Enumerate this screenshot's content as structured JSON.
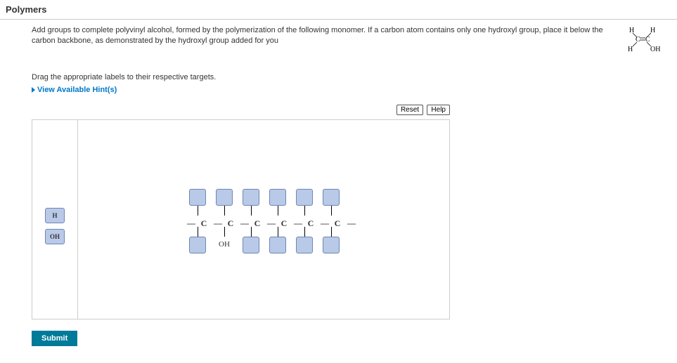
{
  "title": "Polymers",
  "instruction": "Add groups to complete polyvinyl alcohol, formed by the polymerization of the following monomer. If a carbon atom contains only one hydroxyl group, place it below the carbon backbone, as demonstrated by the hydroxyl group added for you",
  "monomer": {
    "tl": "H",
    "tr": "H",
    "center": "C   C",
    "bl": "H",
    "br": "OH"
  },
  "sub_instruction": "Drag the appropriate labels to their respective targets.",
  "hints_label": "View Available Hint(s)",
  "toolbar": {
    "reset": "Reset",
    "help": "Help"
  },
  "palette": {
    "h": "H",
    "oh": "OH"
  },
  "chain": {
    "c": "C",
    "provided_label": "OH"
  },
  "submit": "Submit"
}
